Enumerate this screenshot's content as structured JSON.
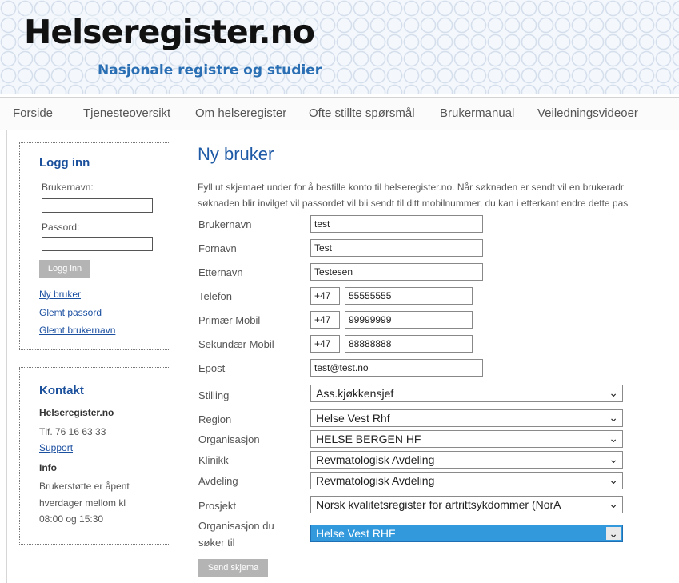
{
  "header": {
    "brand": "Helseregister.no",
    "tagline": "Nasjonale registre og studier"
  },
  "nav": {
    "items": [
      "Forside",
      "Tjenesteoversikt",
      "Om helseregister",
      "Ofte stillte spørsmål",
      "Brukermanual",
      "Veiledningsvideoer"
    ]
  },
  "login": {
    "title": "Logg inn",
    "username_label": "Brukernavn:",
    "password_label": "Passord:",
    "button": "Logg inn",
    "links": [
      "Ny bruker",
      "Glemt passord",
      "Glemt brukernavn"
    ]
  },
  "contact": {
    "title": "Kontakt",
    "org": "Helseregister.no",
    "phone": "Tlf. 76 16 63 33",
    "support": "Support",
    "info_title": "Info",
    "info_lines": [
      "Brukerstøtte er åpent",
      "hverdager mellom kl",
      "08:00 og 15:30"
    ]
  },
  "form": {
    "title": "Ny bruker",
    "intro_lines": [
      "Fyll ut skjemaet under for å bestille konto til helseregister.no. Når søknaden er sendt vil en brukeradr",
      "søknaden blir invilget vil passordet vil bli sendt til ditt mobilnummer, du kan i etterkant endre dette pas"
    ],
    "labels": {
      "brukernavn": "Brukernavn",
      "fornavn": "Fornavn",
      "etternavn": "Etternavn",
      "telefon": "Telefon",
      "primaer_mobil": "Primær Mobil",
      "sekundaer_mobil": "Sekundær Mobil",
      "epost": "Epost",
      "stilling": "Stilling",
      "region": "Region",
      "organisasjon": "Organisasjon",
      "klinikk": "Klinikk",
      "avdeling": "Avdeling",
      "prosjekt": "Prosjekt",
      "org_soker_line1": "Organisasjon du",
      "org_soker_line2": "søker til"
    },
    "values": {
      "brukernavn": "test",
      "fornavn": "Test",
      "etternavn": "Testesen",
      "telefon_prefix": "+47",
      "telefon": "55555555",
      "primaer_prefix": "+47",
      "primaer_mobil": "99999999",
      "sekundaer_prefix": "+47",
      "sekundaer_mobil": "88888888",
      "epost": "test@test.no",
      "stilling": "Ass.kjøkkensjef",
      "region": "Helse Vest Rhf",
      "organisasjon": "HELSE BERGEN HF",
      "klinikk": "Revmatologisk Avdeling",
      "avdeling": "Revmatologisk Avdeling",
      "prosjekt": "Norsk kvalitetsregister for artrittsykdommer (NorA",
      "org_soker": "Helse Vest RHF"
    },
    "submit": "Send skjema"
  },
  "icons": {
    "select_arrow": "chevron-down-icon"
  },
  "colors": {
    "link": "#1b4fa0",
    "title": "#1f5aa6",
    "highlight": "#3399dd",
    "button": "#b4b4b4"
  }
}
